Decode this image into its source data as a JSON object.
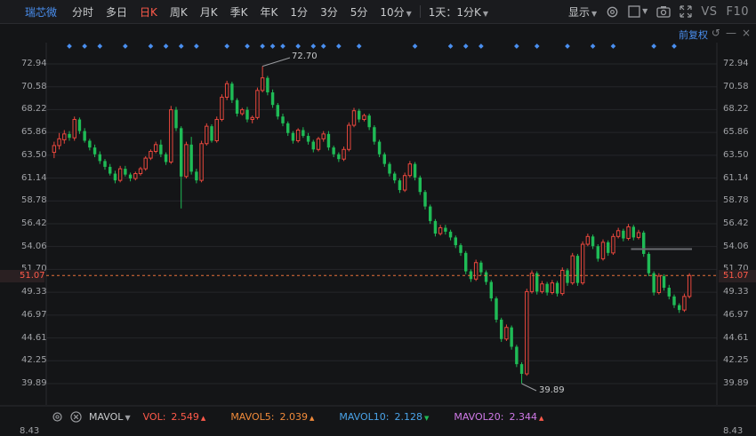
{
  "toolbar": {
    "stock_name": "瑞芯微",
    "periods": [
      "分时",
      "多日",
      "日K",
      "周K",
      "月K",
      "季K",
      "年K",
      "1分",
      "3分",
      "5分",
      "10分",
      "1天：1分K"
    ],
    "active_period": "日K",
    "display_label": "显示",
    "vs_label": "VS",
    "f10_label": "F10"
  },
  "subbar": {
    "adjust_label": "前复权"
  },
  "price_axis": {
    "ticks": [
      "72.94",
      "70.58",
      "68.22",
      "65.86",
      "63.50",
      "61.14",
      "58.78",
      "56.42",
      "54.06",
      "51.70",
      "49.33",
      "46.97",
      "44.61",
      "42.25",
      "39.89"
    ],
    "current_price": "51.07"
  },
  "annotations": {
    "high": "72.70",
    "low": "39.89"
  },
  "indicators": {
    "name": "MAVOL",
    "items": [
      {
        "label": "VOL:",
        "value": "2.549",
        "color": "#ff5a4a"
      },
      {
        "label": "MAVOL5:",
        "value": "2.039",
        "color": "#f08a3a"
      },
      {
        "label": "MAVOL10:",
        "value": "2.128",
        "color": "#4aa3e8"
      },
      {
        "label": "MAVOL20:",
        "value": "2.344",
        "color": "#d07ae8"
      }
    ]
  },
  "volume_axis": {
    "top_tick": "8.43"
  },
  "colors": {
    "up": "#e8473d",
    "down": "#1fbb56",
    "price_line": "#e8703a",
    "accent": "#4a8ff0"
  },
  "chart_data": {
    "type": "candlestick",
    "ylim": [
      39.89,
      72.94
    ],
    "ohlc": [
      [
        63.8,
        64.9,
        63.2,
        64.5
      ],
      [
        64.5,
        65.8,
        64.1,
        65.2
      ],
      [
        65.1,
        66.1,
        64.7,
        65.7
      ],
      [
        65.7,
        66.0,
        65.0,
        65.3
      ],
      [
        65.3,
        67.5,
        65.0,
        67.2
      ],
      [
        67.2,
        67.4,
        65.7,
        66.0
      ],
      [
        66.0,
        66.3,
        64.8,
        65.0
      ],
      [
        65.0,
        65.2,
        64.0,
        64.3
      ],
      [
        64.3,
        64.6,
        63.3,
        63.6
      ],
      [
        63.6,
        63.9,
        62.6,
        62.9
      ],
      [
        62.9,
        63.1,
        62.0,
        62.3
      ],
      [
        62.3,
        62.6,
        61.4,
        61.6
      ],
      [
        61.6,
        61.9,
        60.6,
        60.9
      ],
      [
        60.9,
        62.4,
        60.7,
        62.1
      ],
      [
        62.1,
        62.4,
        61.3,
        61.5
      ],
      [
        61.5,
        61.7,
        60.8,
        61.1
      ],
      [
        61.1,
        61.8,
        60.9,
        61.6
      ],
      [
        61.6,
        62.3,
        61.4,
        62.1
      ],
      [
        62.1,
        63.4,
        61.9,
        63.2
      ],
      [
        63.2,
        64.1,
        63.0,
        63.9
      ],
      [
        63.9,
        64.9,
        63.7,
        64.6
      ],
      [
        64.6,
        65.1,
        63.3,
        63.6
      ],
      [
        63.6,
        63.8,
        62.5,
        62.8
      ],
      [
        62.8,
        68.6,
        62.6,
        68.2
      ],
      [
        68.2,
        68.5,
        66.0,
        66.3
      ],
      [
        66.3,
        66.5,
        58.0,
        61.3
      ],
      [
        61.3,
        64.9,
        61.1,
        64.6
      ],
      [
        64.6,
        65.4,
        61.5,
        61.8
      ],
      [
        61.8,
        62.1,
        60.6,
        60.9
      ],
      [
        60.9,
        65.0,
        60.7,
        64.7
      ],
      [
        64.7,
        66.8,
        64.5,
        66.5
      ],
      [
        66.5,
        66.7,
        64.8,
        65.0
      ],
      [
        65.0,
        67.5,
        64.8,
        67.2
      ],
      [
        67.2,
        69.8,
        67.0,
        69.5
      ],
      [
        69.5,
        71.2,
        69.2,
        70.9
      ],
      [
        70.9,
        71.1,
        68.9,
        69.2
      ],
      [
        69.2,
        69.4,
        67.5,
        67.8
      ],
      [
        67.8,
        68.4,
        67.6,
        68.2
      ],
      [
        68.2,
        68.5,
        66.9,
        67.2
      ],
      [
        67.2,
        67.6,
        66.8,
        67.4
      ],
      [
        67.4,
        70.5,
        67.2,
        70.2
      ],
      [
        70.2,
        72.7,
        70.0,
        71.5
      ],
      [
        71.5,
        71.7,
        69.7,
        70.0
      ],
      [
        70.0,
        70.3,
        68.4,
        68.7
      ],
      [
        68.7,
        68.9,
        67.2,
        67.5
      ],
      [
        67.5,
        67.8,
        66.5,
        66.8
      ],
      [
        66.8,
        67.0,
        65.5,
        65.8
      ],
      [
        65.8,
        66.0,
        64.7,
        65.0
      ],
      [
        65.0,
        66.3,
        64.8,
        66.1
      ],
      [
        66.1,
        66.4,
        65.3,
        65.5
      ],
      [
        65.5,
        65.8,
        64.6,
        64.9
      ],
      [
        64.9,
        65.1,
        63.8,
        64.1
      ],
      [
        64.1,
        65.4,
        63.9,
        65.2
      ],
      [
        65.2,
        66.0,
        64.9,
        65.7
      ],
      [
        65.7,
        66.0,
        64.0,
        64.3
      ],
      [
        64.3,
        64.5,
        63.3,
        63.6
      ],
      [
        63.6,
        63.8,
        62.8,
        63.1
      ],
      [
        63.1,
        64.4,
        62.9,
        64.1
      ],
      [
        64.1,
        66.9,
        63.9,
        66.6
      ],
      [
        66.6,
        68.4,
        66.4,
        68.1
      ],
      [
        68.1,
        68.3,
        66.9,
        67.2
      ],
      [
        67.2,
        67.8,
        67.0,
        67.6
      ],
      [
        67.6,
        67.8,
        66.1,
        66.4
      ],
      [
        66.4,
        66.6,
        64.6,
        64.9
      ],
      [
        64.9,
        65.1,
        63.3,
        63.6
      ],
      [
        63.6,
        63.8,
        62.3,
        62.6
      ],
      [
        62.6,
        62.8,
        61.3,
        61.6
      ],
      [
        61.6,
        61.8,
        60.6,
        60.9
      ],
      [
        60.9,
        61.1,
        59.6,
        59.9
      ],
      [
        59.9,
        61.7,
        59.7,
        61.4
      ],
      [
        61.4,
        62.9,
        61.2,
        62.6
      ],
      [
        62.6,
        62.8,
        60.9,
        61.2
      ],
      [
        61.2,
        61.4,
        59.4,
        59.7
      ],
      [
        59.7,
        59.9,
        57.9,
        58.2
      ],
      [
        58.2,
        58.4,
        56.4,
        56.7
      ],
      [
        56.7,
        56.9,
        55.1,
        55.4
      ],
      [
        55.4,
        56.3,
        55.2,
        56.0
      ],
      [
        56.0,
        56.3,
        55.3,
        55.6
      ],
      [
        55.6,
        55.8,
        54.7,
        55.0
      ],
      [
        55.0,
        55.2,
        53.9,
        54.2
      ],
      [
        54.2,
        54.4,
        53.1,
        53.4
      ],
      [
        53.4,
        53.6,
        51.2,
        51.5
      ],
      [
        51.5,
        51.7,
        50.4,
        50.7
      ],
      [
        50.7,
        52.7,
        50.5,
        52.4
      ],
      [
        52.4,
        52.6,
        51.1,
        51.4
      ],
      [
        51.4,
        51.6,
        50.1,
        50.4
      ],
      [
        50.4,
        50.6,
        48.4,
        48.7
      ],
      [
        48.7,
        48.9,
        46.2,
        46.5
      ],
      [
        46.5,
        46.7,
        44.2,
        44.5
      ],
      [
        44.5,
        46.0,
        44.3,
        45.7
      ],
      [
        45.7,
        45.9,
        43.4,
        43.7
      ],
      [
        43.7,
        43.9,
        41.6,
        41.9
      ],
      [
        41.9,
        42.1,
        39.89,
        40.9
      ],
      [
        40.9,
        49.7,
        40.7,
        49.4
      ],
      [
        49.4,
        51.6,
        49.2,
        51.3
      ],
      [
        51.3,
        51.5,
        49.1,
        49.4
      ],
      [
        49.4,
        50.5,
        49.2,
        50.2
      ],
      [
        50.2,
        50.4,
        49.0,
        49.3
      ],
      [
        49.3,
        50.6,
        49.1,
        50.3
      ],
      [
        50.3,
        50.5,
        48.9,
        49.2
      ],
      [
        49.2,
        51.9,
        49.0,
        51.6
      ],
      [
        51.6,
        51.8,
        50.0,
        50.3
      ],
      [
        50.3,
        53.4,
        50.1,
        53.1
      ],
      [
        53.1,
        53.3,
        50.0,
        50.3
      ],
      [
        50.3,
        54.6,
        50.1,
        54.3
      ],
      [
        54.3,
        55.4,
        54.1,
        55.1
      ],
      [
        55.1,
        55.3,
        53.8,
        54.1
      ],
      [
        54.1,
        54.3,
        52.5,
        52.8
      ],
      [
        52.8,
        54.8,
        52.6,
        54.5
      ],
      [
        54.5,
        54.7,
        53.1,
        53.4
      ],
      [
        53.4,
        55.4,
        53.2,
        55.1
      ],
      [
        55.1,
        56.0,
        54.9,
        55.7
      ],
      [
        55.7,
        55.9,
        54.6,
        54.9
      ],
      [
        54.9,
        56.4,
        54.7,
        56.1
      ],
      [
        56.1,
        56.3,
        54.7,
        55.0
      ],
      [
        55.0,
        55.8,
        54.8,
        55.5
      ],
      [
        55.5,
        55.7,
        53.0,
        53.3
      ],
      [
        53.3,
        53.5,
        51.0,
        51.3
      ],
      [
        51.3,
        51.5,
        49.0,
        49.3
      ],
      [
        49.3,
        51.3,
        49.1,
        51.0
      ],
      [
        51.0,
        51.2,
        49.5,
        49.8
      ],
      [
        49.8,
        50.1,
        48.6,
        48.9
      ],
      [
        48.9,
        49.1,
        47.7,
        48.0
      ],
      [
        48.0,
        48.2,
        47.2,
        47.5
      ],
      [
        47.5,
        49.2,
        47.3,
        48.9
      ],
      [
        48.9,
        51.3,
        48.7,
        51.07
      ]
    ],
    "volume_ma_line": {
      "label": "horizontal reference",
      "value": 53.8
    }
  }
}
